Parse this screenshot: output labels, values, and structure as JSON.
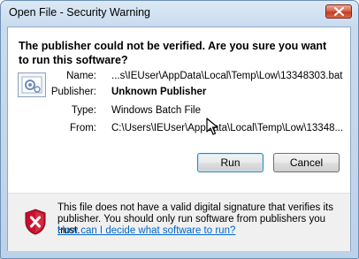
{
  "window": {
    "title": "Open File - Security Warning"
  },
  "header": {
    "message": "The publisher could not be verified.  Are you sure you want to run this software?"
  },
  "details": {
    "name_label": "Name:",
    "name_value": "...s\\IEUser\\AppData\\Local\\Temp\\Low\\13348303.bat",
    "publisher_label": "Publisher:",
    "publisher_value": "Unknown Publisher",
    "type_label": "Type:",
    "type_value": "Windows Batch File",
    "from_label": "From:",
    "from_value": "C:\\Users\\IEUser\\AppData\\Local\\Temp\\Low\\13348..."
  },
  "buttons": {
    "run": "Run",
    "cancel": "Cancel"
  },
  "footer": {
    "message": "This file does not have a valid digital signature that verifies its publisher.  You should only run software from publishers you trust.",
    "link": "How can I decide what software to run?"
  },
  "icons": {
    "close": "close-icon",
    "file": "batch-file-icon",
    "shield": "shield-x-icon",
    "cursor": "mouse-pointer-icon"
  },
  "colors": {
    "link": "#0066cc",
    "shield_red": "#c8102e",
    "close_red": "#c43c20"
  }
}
